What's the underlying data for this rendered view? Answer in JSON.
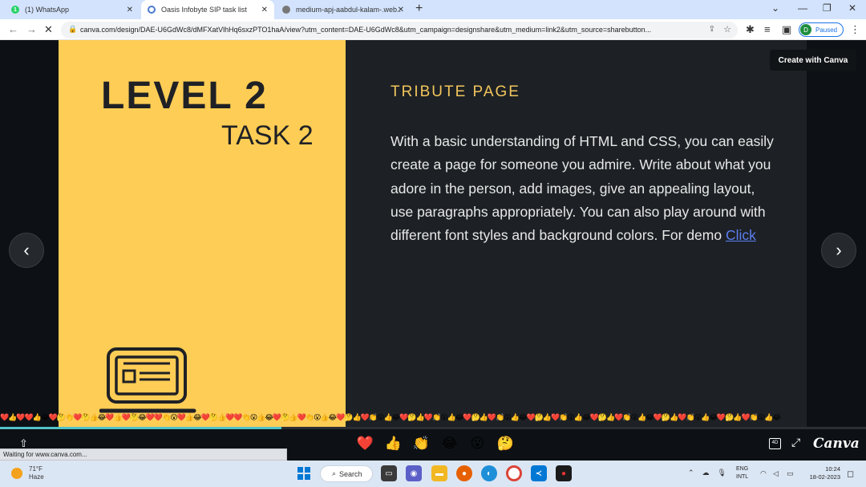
{
  "browser": {
    "tabs": [
      {
        "title": "(1) WhatsApp",
        "active": false
      },
      {
        "title": "Oasis Infobyte SIP task list",
        "active": true
      },
      {
        "title": "medium-apj-aabdul-kalam-.web..",
        "active": false
      }
    ],
    "new_tab": "+",
    "url": "canva.com/design/DAE-U6GdWc8/dMFXatVlhHq6sxzPTO1haA/view?utm_content=DAE-U6GdWc8&utm_campaign=designshare&utm_medium=link2&utm_source=sharebutton...",
    "profile_initial": "D",
    "profile_status": "Paused"
  },
  "slide": {
    "level": "LEVEL 2",
    "task": "TASK 2",
    "title": "TRIBUTE PAGE",
    "body": "With a basic understanding of HTML and CSS, you can easily create a page for someone you admire. Write about what you adore in the person, add images, give an appealing layout, use paragraphs appropriately. You can also play around with different font styles and background colors. For demo ",
    "link_text": "Click"
  },
  "viewer": {
    "create_button": "Create with Canva",
    "prev": "‹",
    "next": "›",
    "progress": 0.325,
    "reactions": [
      "❤️",
      "👍",
      "👏",
      "😂",
      "😮",
      "🤔"
    ],
    "emoji_rain": "❤️👍❤️❤️👍😂❤️🤔👏❤️🤔👍😂❤️👍❤️🤔😂❤️❤️👏😮❤️👍😂❤️🤔👍❤️❤️👏😮👍😂❤️🤔👍❤️👏😮👍😂❤️🤔👍❤️👏😮👍😂❤️🤔👍❤️👏😮👍😂❤️🤔👍❤️👏😮👍😂❤️🤔👍❤️👏😮👍😂❤️🤔👍❤️👏😮👍😂❤️🤔👍❤️👏😮👍😂❤️🤔👍❤️👏😮👍😂",
    "logo": "Canva",
    "present_label": "4D"
  },
  "status_bar": "Waiting for www.canva.com...",
  "taskbar": {
    "weather_temp": "71°F",
    "weather_desc": "Haze",
    "search": "Search",
    "lang1": "ENG",
    "lang2": "INTL",
    "time": "10:24",
    "date": "18-02-2023"
  }
}
